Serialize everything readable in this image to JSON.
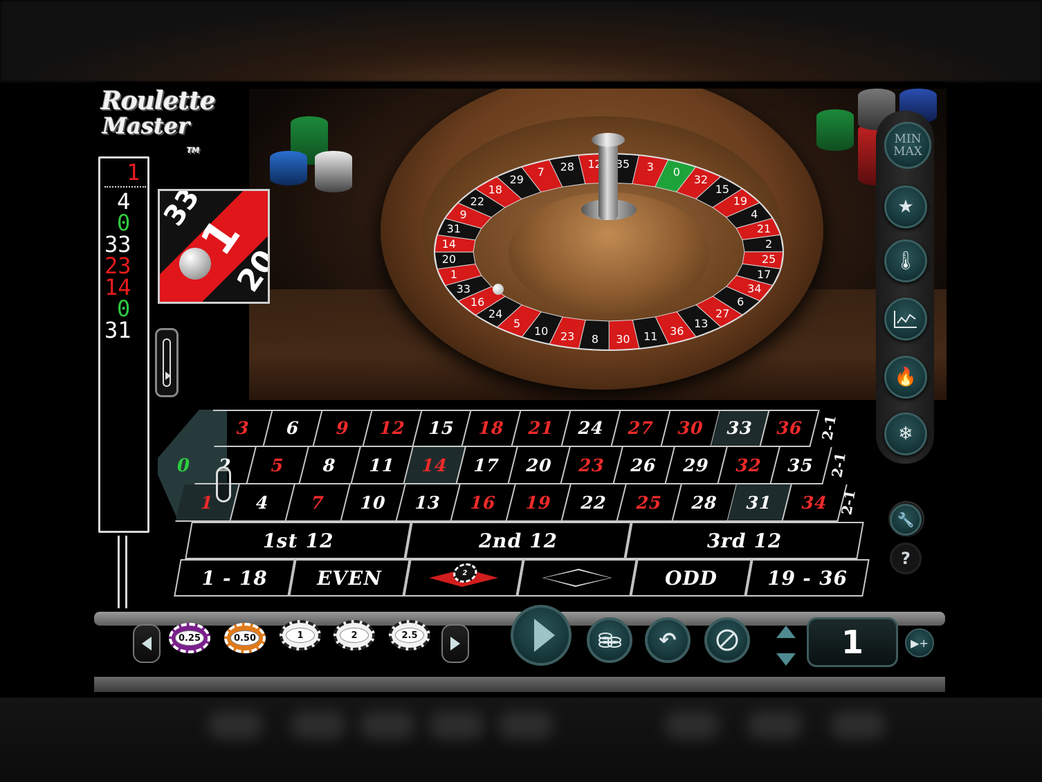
{
  "logo": {
    "line1": "Roulette",
    "line2": "Master",
    "tm": "TM"
  },
  "history": {
    "last": {
      "value": "1",
      "color": "#e81b1b"
    },
    "items": [
      {
        "value": "4",
        "color": "#ffffff"
      },
      {
        "value": "0",
        "color": "#2ecc40"
      },
      {
        "value": "33",
        "color": "#ffffff"
      },
      {
        "value": "23",
        "color": "#e81b1b"
      },
      {
        "value": "14",
        "color": "#e81b1b"
      },
      {
        "value": "0",
        "color": "#2ecc40"
      },
      {
        "value": "31",
        "color": "#ffffff"
      }
    ]
  },
  "zoom": {
    "winning": "1",
    "left": "33",
    "right": "20"
  },
  "wheel": {
    "numbers_top": [
      "28",
      "12",
      "35",
      "3",
      "0",
      "32",
      "15",
      "19",
      "4",
      "21",
      "2",
      "25",
      "17",
      "34",
      "6",
      "27",
      "13",
      "36",
      "11",
      "30",
      "8",
      "23",
      "10",
      "5",
      "24",
      "16",
      "33",
      "1",
      "20",
      "14",
      "31",
      "9",
      "22",
      "18",
      "29",
      "7"
    ]
  },
  "side_buttons": {
    "minmax": [
      "MIN",
      "MAX"
    ],
    "favorites_icon": "star-card-icon",
    "hot_cold_icon": "thermometer-icon",
    "stats_icon": "line-chart-icon",
    "hot_icon": "flame-icon",
    "cold_icon": "snowflake-icon",
    "settings_icon": "wrench-icon",
    "help_label": "?"
  },
  "board": {
    "zero": "0",
    "rows": [
      [
        "3",
        "6",
        "9",
        "12",
        "15",
        "18",
        "21",
        "24",
        "27",
        "30",
        "33",
        "36"
      ],
      [
        "2",
        "5",
        "8",
        "11",
        "14",
        "17",
        "20",
        "23",
        "26",
        "29",
        "32",
        "35"
      ],
      [
        "1",
        "4",
        "7",
        "10",
        "13",
        "16",
        "19",
        "22",
        "25",
        "28",
        "31",
        "34"
      ]
    ],
    "red": [
      "1",
      "3",
      "5",
      "7",
      "9",
      "12",
      "14",
      "16",
      "18",
      "19",
      "21",
      "23",
      "25",
      "27",
      "30",
      "32",
      "34",
      "36"
    ],
    "column_bets": [
      "2-1",
      "2-1",
      "2-1"
    ],
    "dozens": [
      "1st 12",
      "2nd 12",
      "3rd 12"
    ],
    "outside": {
      "low": "1 - 18",
      "even": "EVEN",
      "odd": "ODD",
      "high": "19 - 36"
    },
    "chip_on_red": "2"
  },
  "chips": [
    "0.25",
    "0.50",
    "1",
    "2",
    "2.5"
  ],
  "chip_colors": [
    "#7a1f8c",
    "#e07a1a",
    "#f2f2f2",
    "#f2f2f2",
    "#f2f2f2"
  ],
  "controls": {
    "spin_icon": "play-icon",
    "stack_icon": "chips-stack-icon",
    "undo_icon": "undo-icon",
    "clear_icon": "clear-bets-icon",
    "bet_value": "1",
    "max_bet_icon": "play-plus-icon"
  }
}
